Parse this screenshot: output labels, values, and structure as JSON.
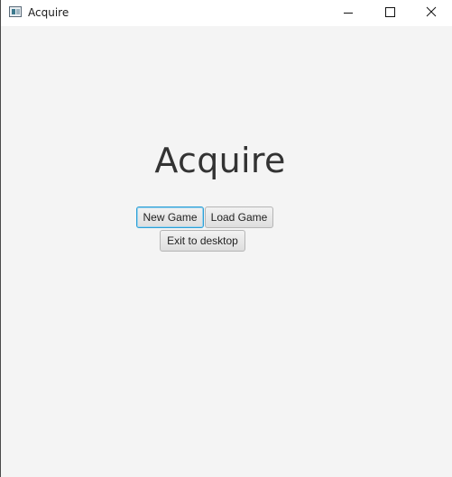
{
  "window": {
    "title": "Acquire",
    "icon": "app-window-icon",
    "controls": {
      "minimize_icon": "minimize-icon",
      "maximize_icon": "maximize-icon",
      "close_icon": "close-icon"
    }
  },
  "main": {
    "heading": "Acquire",
    "buttons": {
      "new_game": "New Game",
      "load_game": "Load Game",
      "exit": "Exit to desktop"
    },
    "focused_button": "New Game"
  },
  "colors": {
    "background": "#f4f4f4",
    "titlebar": "#ffffff",
    "focus_border": "#2a9fd6",
    "heading_text": "#333333"
  }
}
